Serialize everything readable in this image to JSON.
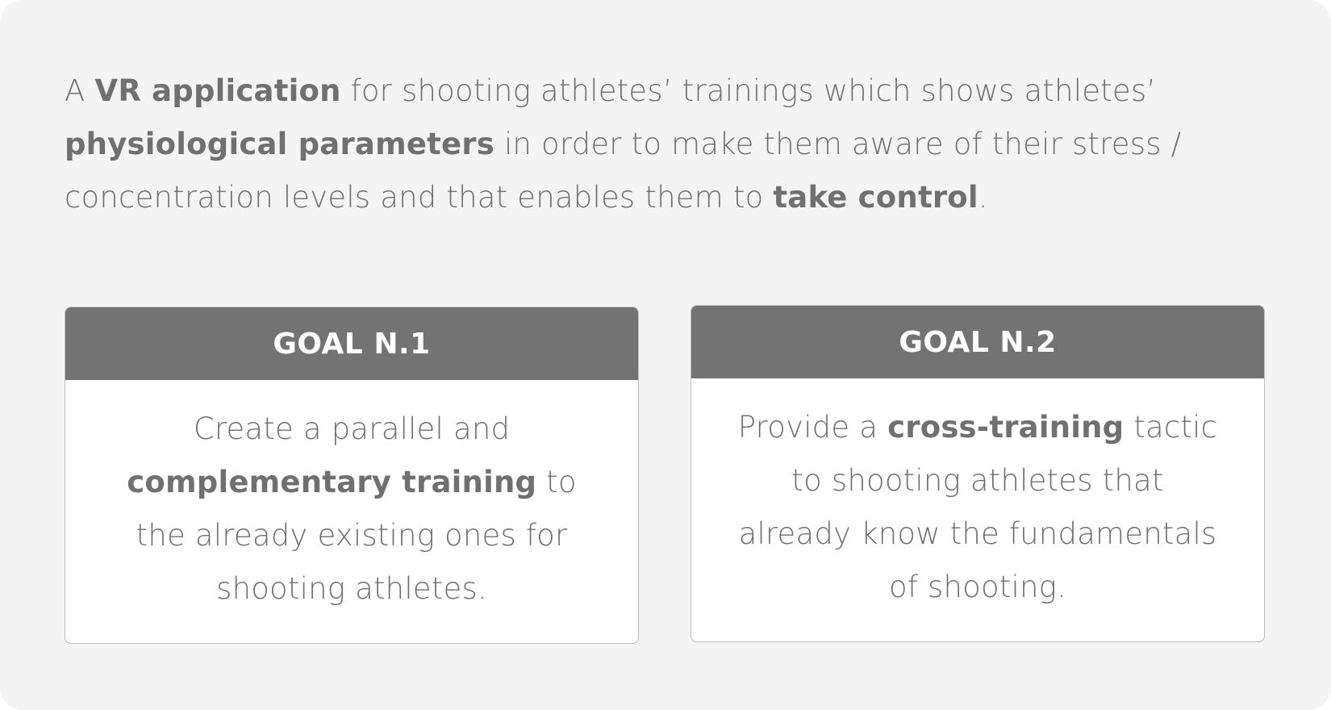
{
  "intro": {
    "t1": "A ",
    "b1": "VR application",
    "t2": " for shooting athletes’ trainings which shows athletes’ ",
    "b2": "physiological parameters",
    "t3": " in order to make them aware of their stress / concentration levels and that enables them to ",
    "b3": "take control",
    "t4": "."
  },
  "goals": [
    {
      "title": "GOAL N.1",
      "t1": "Create a parallel and ",
      "b1": "complementary training",
      "t2": " to the already existing ones for shooting athletes."
    },
    {
      "title": "GOAL N.2",
      "t1": "Provide a ",
      "b1": "cross-training",
      "t2": " tactic to shooting athletes that already know the fundamentals of shooting."
    }
  ]
}
